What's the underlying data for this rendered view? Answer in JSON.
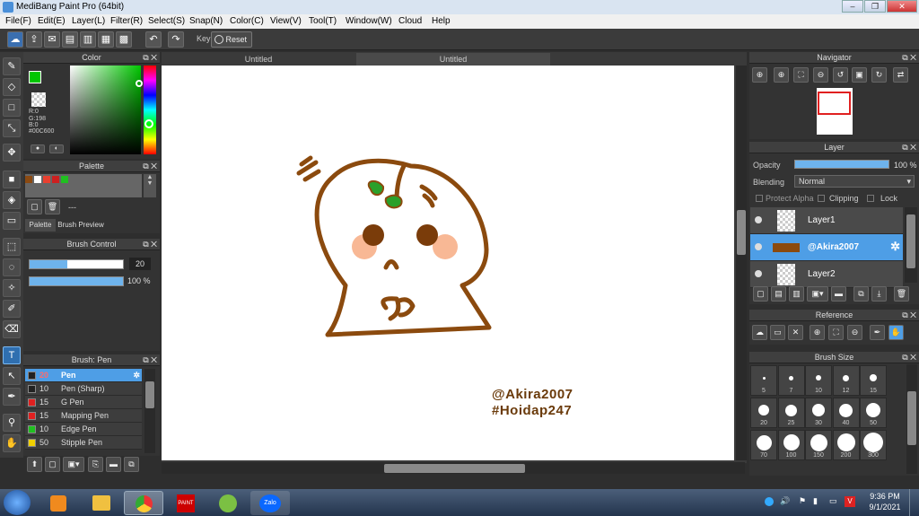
{
  "window": {
    "title": "MediBang Paint Pro (64bit)"
  },
  "menu": [
    "File(F)",
    "Edit(E)",
    "Layer(L)",
    "Filter(R)",
    "Select(S)",
    "Snap(N)",
    "Color(C)",
    "View(V)",
    "Tool(T)",
    "Window(W)",
    "Cloud",
    "Help"
  ],
  "toolbar": {
    "key_label": "Key",
    "reset_label": "Reset"
  },
  "color_panel": {
    "title": "Color",
    "r": "R:0",
    "g": "G:198",
    "b": "B:0",
    "hex": "#00C600",
    "fg_color": "#00c600"
  },
  "palette_panel": {
    "title": "Palette",
    "dash": "---",
    "tab_palette": "Palette",
    "tab_preview": "Brush Preview",
    "swatches": [
      "#8b4a12",
      "#ffffff",
      "#e84030",
      "#cc2020",
      "#20c020"
    ]
  },
  "brush_control": {
    "title": "Brush Control",
    "size": "20",
    "opacity": "100 %"
  },
  "brush_list": {
    "title": "Brush: Pen",
    "items": [
      {
        "size": "20",
        "name": "Pen",
        "color": "#222222"
      },
      {
        "size": "10",
        "name": "Pen (Sharp)",
        "color": "#222222"
      },
      {
        "size": "15",
        "name": "G Pen",
        "color": "#e02020"
      },
      {
        "size": "15",
        "name": "Mapping Pen",
        "color": "#e02020"
      },
      {
        "size": "10",
        "name": "Edge Pen",
        "color": "#20c020"
      },
      {
        "size": "50",
        "name": "Stipple Pen",
        "color": "#f0d000"
      }
    ]
  },
  "doc_tabs": [
    "Untitled",
    "Untitled"
  ],
  "canvas": {
    "watermark_line1": "@Akira2007",
    "watermark_line2": "#Hoidap247"
  },
  "navigator": {
    "title": "Navigator"
  },
  "layer_panel": {
    "title": "Layer",
    "opacity_label": "Opacity",
    "opacity_value": "100 %",
    "blending_label": "Blending",
    "blending_value": "Normal",
    "protect_alpha": "Protect Alpha",
    "clipping": "Clipping",
    "lock": "Lock",
    "layers": [
      "Layer1",
      "@Akira2007",
      "Layer2"
    ]
  },
  "reference": {
    "title": "Reference"
  },
  "brush_size": {
    "title": "Brush Size",
    "sizes": [
      "5",
      "7",
      "10",
      "12",
      "15",
      "20",
      "25",
      "30",
      "40",
      "50",
      "70",
      "100",
      "150",
      "200",
      "300"
    ]
  },
  "taskbar": {
    "time": "9:36 PM",
    "date": "9/1/2021",
    "zalo": "Zalo"
  }
}
